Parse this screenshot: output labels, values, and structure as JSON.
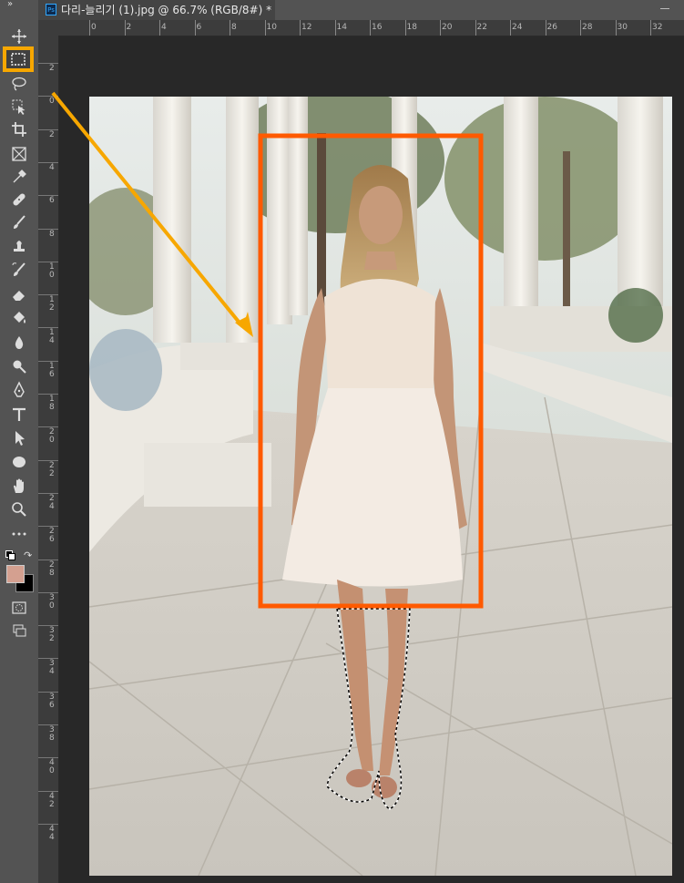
{
  "document_tab": {
    "icon_label": "Ps",
    "title": "다리-늘리기 (1).jpg @ 66.7% (RGB/8#) *"
  },
  "toolbar": {
    "collapse_label": "»",
    "tools": [
      {
        "name": "move-tool",
        "icon": "move"
      },
      {
        "name": "rectangular-marquee-tool",
        "icon": "marquee",
        "highlighted": true
      },
      {
        "name": "lasso-tool",
        "icon": "lasso"
      },
      {
        "name": "object-selection-tool",
        "icon": "object-select"
      },
      {
        "name": "crop-tool",
        "icon": "crop"
      },
      {
        "name": "frame-tool",
        "icon": "frame"
      },
      {
        "name": "eyedropper-tool",
        "icon": "eyedropper"
      },
      {
        "name": "healing-brush-tool",
        "icon": "bandage"
      },
      {
        "name": "brush-tool",
        "icon": "brush"
      },
      {
        "name": "clone-stamp-tool",
        "icon": "stamp"
      },
      {
        "name": "history-brush-tool",
        "icon": "history-brush"
      },
      {
        "name": "eraser-tool",
        "icon": "eraser"
      },
      {
        "name": "paint-bucket-tool",
        "icon": "bucket"
      },
      {
        "name": "blur-tool",
        "icon": "drop"
      },
      {
        "name": "dodge-tool",
        "icon": "dodge"
      },
      {
        "name": "pen-tool",
        "icon": "pen"
      },
      {
        "name": "type-tool",
        "icon": "type"
      },
      {
        "name": "path-selection-tool",
        "icon": "arrow"
      },
      {
        "name": "ellipse-tool",
        "icon": "ellipse"
      },
      {
        "name": "hand-tool",
        "icon": "hand"
      },
      {
        "name": "zoom-tool",
        "icon": "zoom"
      },
      {
        "name": "edit-toolbar",
        "icon": "more"
      }
    ],
    "foreground_color": "#d4a090",
    "background_color": "#000000"
  },
  "rulers": {
    "horizontal": [
      "0",
      "2",
      "4",
      "6",
      "8",
      "10",
      "12",
      "14",
      "16",
      "18",
      "20",
      "22",
      "24",
      "26",
      "28",
      "30",
      "32"
    ],
    "vertical": [
      "2",
      "0",
      "2",
      "4",
      "6",
      "8",
      "1\n0",
      "1\n2",
      "1\n4",
      "1\n6",
      "1\n8",
      "2\n0",
      "2\n2",
      "2\n4",
      "2\n6",
      "2\n8",
      "3\n0",
      "3\n2",
      "3\n4",
      "3\n6",
      "3\n8",
      "4\n0",
      "4\n2",
      "4\n4"
    ]
  },
  "colors": {
    "highlight": "#f7a700",
    "selection_box": "#ff5a00",
    "ps_blue": "#31a8ff"
  }
}
